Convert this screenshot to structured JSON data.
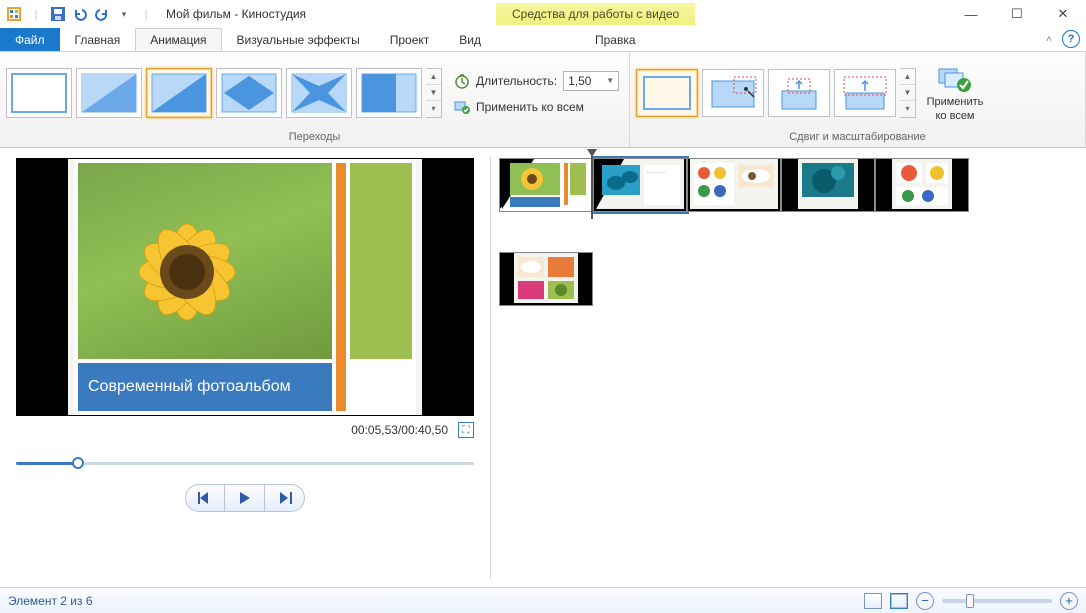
{
  "titlebar": {
    "title": "Мой фильм - Киностудия",
    "context_title": "Средства для работы с видео"
  },
  "tabs": {
    "file": "Файл",
    "home": "Главная",
    "animation": "Анимация",
    "effects": "Визуальные эффекты",
    "project": "Проект",
    "view": "Вид",
    "edit": "Правка"
  },
  "ribbon": {
    "transitions_label": "Переходы",
    "duration_label": "Длительность:",
    "duration_value": "1,50",
    "apply_all_label": "Применить ко всем",
    "panzoom_label": "Сдвиг и масштабирование",
    "apply_all_btn_l1": "Применить",
    "apply_all_btn_l2": "ко всем"
  },
  "preview": {
    "caption": "Современный фотоальбом",
    "timecode": "00:05,53/00:40,50"
  },
  "status": {
    "item_text": "Элемент 2 из 6"
  }
}
